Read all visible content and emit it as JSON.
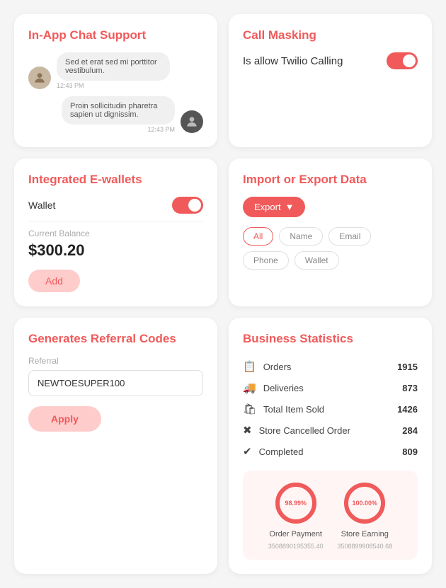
{
  "chatSupport": {
    "title": "In-App Chat Support",
    "messages": [
      {
        "id": 1,
        "side": "left",
        "text": "Sed et erat sed mi porttitor vestibulum.",
        "time": "12:43 PM"
      },
      {
        "id": 2,
        "side": "right",
        "text": "Proin sollicitudin pharetra sapien ut dignissim.",
        "time": "12:43 PM"
      }
    ]
  },
  "ewallets": {
    "title": "Integrated E-wallets",
    "walletLabel": "Wallet",
    "walletEnabled": true,
    "balanceLabel": "Current Balance",
    "balance": "$300.20",
    "addButtonLabel": "Add"
  },
  "referral": {
    "title": "Generates Referral Codes",
    "inputLabel": "Referral",
    "inputValue": "NEWTOESUPER100",
    "applyLabel": "Apply"
  },
  "callMasking": {
    "title": "Call Masking",
    "description": "Is allow Twilio Calling",
    "enabled": true
  },
  "importExport": {
    "title": "Import or Export Data",
    "exportLabel": "Export",
    "filters": [
      {
        "id": "all",
        "label": "All",
        "active": true
      },
      {
        "id": "name",
        "label": "Name",
        "active": false
      },
      {
        "id": "email",
        "label": "Email",
        "active": false
      },
      {
        "id": "phone",
        "label": "Phone",
        "active": false
      },
      {
        "id": "wallet",
        "label": "Wallet",
        "active": false
      }
    ]
  },
  "businessStats": {
    "title": "Business Statistics",
    "stats": [
      {
        "id": "orders",
        "icon": "📋",
        "label": "Orders",
        "value": "1915"
      },
      {
        "id": "deliveries",
        "icon": "🚚",
        "label": "Deliveries",
        "value": "873"
      },
      {
        "id": "total-items",
        "icon": "🛍",
        "label": "Total Item Sold",
        "value": "1426"
      },
      {
        "id": "cancelled",
        "icon": "❌",
        "label": "Store Cancelled Order",
        "value": "284"
      },
      {
        "id": "completed",
        "icon": "✅",
        "label": "Completed",
        "value": "809"
      }
    ],
    "charts": [
      {
        "id": "order-payment",
        "percentage": "98.99%",
        "progress": 98.99,
        "title": "Order Payment",
        "amount": "3508890195355.40"
      },
      {
        "id": "store-earning",
        "percentage": "100.00%",
        "progress": 100,
        "title": "Store Earning",
        "amount": "3508899908540.68"
      }
    ]
  },
  "colors": {
    "primary": "#f05a5a",
    "primaryLight": "#fcc",
    "bgLight": "#fff5f5"
  }
}
